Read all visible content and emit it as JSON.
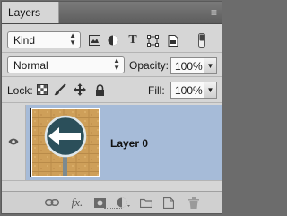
{
  "panel": {
    "tab_label": "Layers",
    "close_glyph": "×",
    "menu_glyph": "≡"
  },
  "filter": {
    "kind_value": "Kind",
    "icons": [
      "image-filter-icon",
      "adjustment-filter-icon",
      "type-filter-icon",
      "shape-filter-icon",
      "smart-object-filter-icon",
      "filter-toggle-icon"
    ]
  },
  "blend": {
    "mode_value": "Normal",
    "opacity_label": "Opacity:",
    "opacity_value": "100%"
  },
  "lock": {
    "label": "Lock:",
    "fill_label": "Fill:",
    "fill_value": "100%"
  },
  "layers": [
    {
      "name": "Layer 0",
      "visible": true,
      "selected": true
    }
  ],
  "colors": {
    "selection": "#a6bbd8",
    "panel_bg": "#d6d6d6"
  },
  "bottom_icons": [
    "link-layers-icon",
    "fx-icon",
    "add-mask-icon",
    "adjustment-layer-icon",
    "new-group-icon",
    "new-layer-icon",
    "trash-icon"
  ],
  "fx_text": "fx."
}
